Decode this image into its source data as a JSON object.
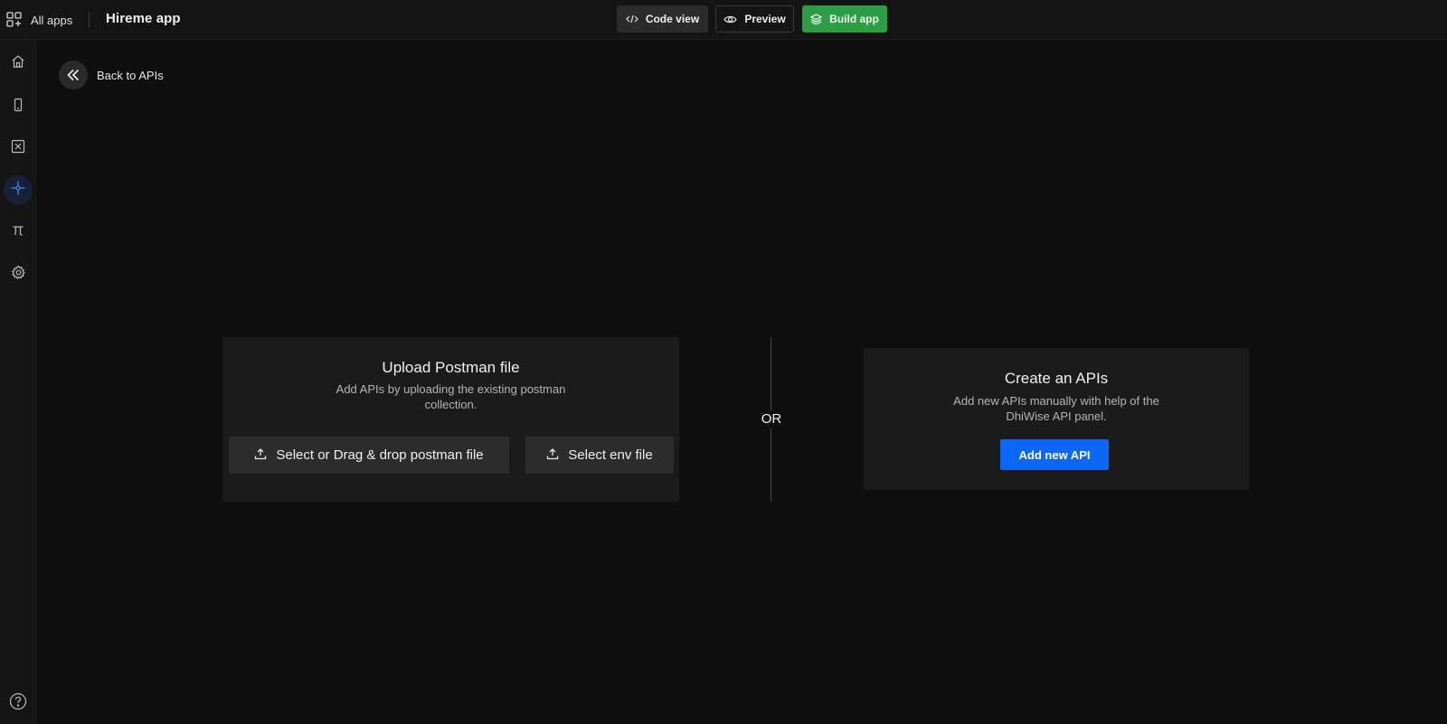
{
  "header": {
    "all_apps_label": "All apps",
    "app_name": "Hireme app",
    "code_view_label": "Code view",
    "preview_label": "Preview",
    "build_label": "Build app"
  },
  "sidebar": {
    "items": [
      {
        "icon": "home-icon",
        "active": false
      },
      {
        "icon": "mobile-screen-icon",
        "active": false
      },
      {
        "icon": "variable-icon",
        "active": false
      },
      {
        "icon": "api-icon",
        "active": true
      },
      {
        "icon": "constants-icon",
        "active": false
      },
      {
        "icon": "settings-icon",
        "active": false
      }
    ],
    "bottom_icon": "help-icon"
  },
  "back_link": {
    "label": "Back to APIs"
  },
  "upload_card": {
    "title": "Upload Postman file",
    "description": "Add APIs by uploading the existing postman collection.",
    "postman_button_label": "Select or Drag & drop postman file",
    "env_button_label": "Select env file"
  },
  "separator": {
    "label": "OR"
  },
  "create_card": {
    "title": "Create an APIs",
    "description": "Add new APIs manually with help of the DhiWise API panel.",
    "button_label": "Add new API"
  },
  "colors": {
    "background": "#0f0f0f",
    "card": "#1b1b1b",
    "accent_blue": "#0d67f5",
    "build_green": "#2e9e45",
    "active_icon": "#2f7cf6"
  }
}
